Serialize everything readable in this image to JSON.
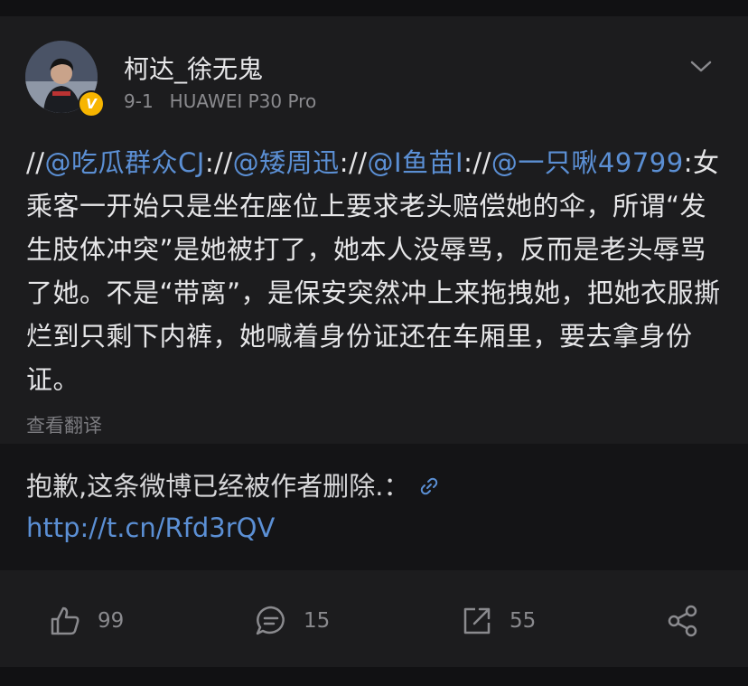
{
  "post": {
    "username": "柯达_徐无鬼",
    "date": "9-1",
    "device": "HUAWEI P30 Pro",
    "verified_badge": "V",
    "body": {
      "s1": "//",
      "m1": "@吃瓜群众CJ",
      "s2": "://",
      "m2": "@矮周迅",
      "s3": "://",
      "m3": "@I鱼苗I",
      "s4": "://",
      "m4": "@一只啾49799",
      "s5": ":女乘客一开始只是坐在座位上要求老头赔偿她的伞，所谓“发生肢体冲突”是她被打了，她本人没辱骂，反而是老头辱骂了她。不是“带离”，是保安突然冲上来拖拽她，把她衣服撕烂到只剩下内裤，她喊着身份证还在车厢里，要去拿身份证。"
    },
    "translate_label": "查看翻译"
  },
  "repost": {
    "deleted_text": "抱歉,这条微博已经被作者删除.：",
    "url_text": "http://t.cn/Rfd3rQV"
  },
  "actions": {
    "likes": "99",
    "comments": "15",
    "reposts": "55"
  },
  "colors": {
    "background": "#1c1c1e",
    "link": "#5b8fd4",
    "badge": "#f7b500"
  },
  "icons": {
    "like": "thumbs-up-icon",
    "comment": "comment-icon",
    "repost": "repost-icon",
    "share": "share-icon",
    "more": "chevron-down-icon",
    "url": "link-icon"
  }
}
